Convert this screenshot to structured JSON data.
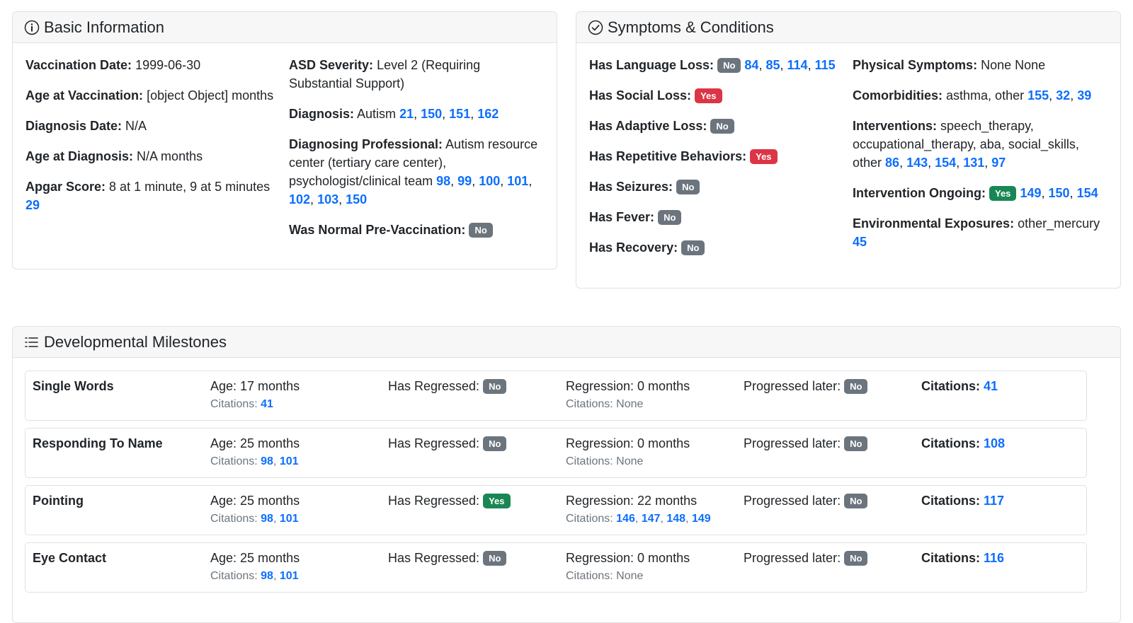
{
  "basic": {
    "title": "Basic Information",
    "vaccination_date_label": "Vaccination Date:",
    "vaccination_date": "1999-06-30",
    "age_vacc_label": "Age at Vaccination:",
    "age_vacc_value": "[object Object]",
    "age_vacc_unit": "months",
    "diag_date_label": "Diagnosis Date:",
    "diag_date": "N/A",
    "age_diag_label": "Age at Diagnosis:",
    "age_diag": "N/A months",
    "apgar_label": "Apgar Score:",
    "apgar": "8 at 1 minute, 9 at 5 minutes",
    "apgar_cites": [
      "29"
    ],
    "asd_label": "ASD Severity:",
    "asd": "Level 2 (Requiring Substantial Support)",
    "diagnosis_label": "Diagnosis:",
    "diagnosis": "Autism",
    "diagnosis_cites": [
      "21",
      "150",
      "151",
      "162"
    ],
    "prof_label": "Diagnosing Professional:",
    "prof": "Autism resource center (tertiary care center), psychologist/clinical team",
    "prof_cites": [
      "98",
      "99",
      "100",
      "101",
      "102",
      "103",
      "150"
    ],
    "normal_label": "Was Normal Pre-Vaccination:",
    "normal_badge": "No"
  },
  "symptoms": {
    "title": "Symptoms & Conditions",
    "lang_label": "Has Language Loss:",
    "lang_badge": "No",
    "lang_cites": [
      "84",
      "85",
      "114",
      "115"
    ],
    "social_label": "Has Social Loss:",
    "social_badge": "Yes",
    "adaptive_label": "Has Adaptive Loss:",
    "adaptive_badge": "No",
    "repetitive_label": "Has Repetitive Behaviors:",
    "repetitive_badge": "Yes",
    "seizures_label": "Has Seizures:",
    "seizures_badge": "No",
    "fever_label": "Has Fever:",
    "fever_badge": "No",
    "recovery_label": "Has Recovery:",
    "recovery_badge": "No",
    "physical_label": "Physical Symptoms:",
    "physical": "None None",
    "comorb_label": "Comorbidities:",
    "comorb": "asthma, other",
    "comorb_cites": [
      "155",
      "32",
      "39"
    ],
    "interv_label": "Interventions:",
    "interv": "speech_therapy, occupational_therapy, aba, social_skills, other",
    "interv_cites": [
      "86",
      "143",
      "154",
      "131",
      "97"
    ],
    "ongoing_label": "Intervention Ongoing:",
    "ongoing_badge": "Yes",
    "ongoing_cites": [
      "149",
      "150",
      "154"
    ],
    "env_label": "Environmental Exposures:",
    "env": "other_mercury",
    "env_cites": [
      "45"
    ]
  },
  "milestones": {
    "title": "Developmental Milestones",
    "rows": [
      {
        "name": "Single Words",
        "age": "Age: 17 months",
        "age_cites": [
          "41"
        ],
        "regressed_label": "Has Regressed:",
        "regressed": "No",
        "regression": "Regression: 0 months",
        "reg_cites_text": "Citations: None",
        "reg_cites": [],
        "progressed_label": "Progressed later:",
        "progressed": "No",
        "cit_label": "Citations:",
        "cites": [
          "41"
        ]
      },
      {
        "name": "Responding To Name",
        "age": "Age: 25 months",
        "age_cites": [
          "98",
          "101"
        ],
        "regressed_label": "Has Regressed:",
        "regressed": "No",
        "regression": "Regression: 0 months",
        "reg_cites_text": "Citations: None",
        "reg_cites": [],
        "progressed_label": "Progressed later:",
        "progressed": "No",
        "cit_label": "Citations:",
        "cites": [
          "108"
        ]
      },
      {
        "name": "Pointing",
        "age": "Age: 25 months",
        "age_cites": [
          "98",
          "101"
        ],
        "regressed_label": "Has Regressed:",
        "regressed": "Yes",
        "regression": "Regression: 22 months",
        "reg_cites_text": "Citations:",
        "reg_cites": [
          "146",
          "147",
          "148",
          "149"
        ],
        "progressed_label": "Progressed later:",
        "progressed": "No",
        "cit_label": "Citations:",
        "cites": [
          "117"
        ]
      },
      {
        "name": "Eye Contact",
        "age": "Age: 25 months",
        "age_cites": [
          "98",
          "101"
        ],
        "regressed_label": "Has Regressed:",
        "regressed": "No",
        "regression": "Regression: 0 months",
        "reg_cites_text": "Citations: None",
        "reg_cites": [],
        "progressed_label": "Progressed later:",
        "progressed": "No",
        "cit_label": "Citations:",
        "cites": [
          "116"
        ]
      }
    ],
    "sub_cit_label": "Citations:"
  },
  "colors": {
    "link": "#0d6efd",
    "badge_no": "#6c757d",
    "badge_yes_red": "#dc3545",
    "badge_yes_green": "#198754"
  }
}
